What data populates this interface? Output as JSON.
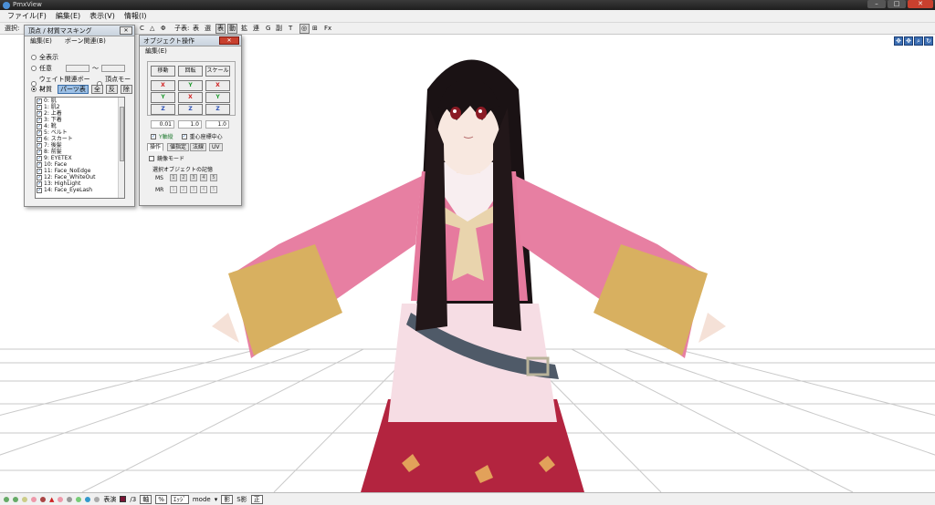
{
  "titlebar": {
    "title": "PmxView"
  },
  "menu": [
    "ファイル(F)",
    "編集(E)",
    "表示(V)",
    "情報(I)"
  ],
  "toolbar": {
    "select_label": "選択:",
    "items": [
      "C",
      "△",
      "Φ",
      "子表:",
      "表",
      "選",
      "表",
      "動",
      "拡",
      "連",
      "G",
      "副",
      "T",
      "Fx"
    ]
  },
  "mask_panel": {
    "title": "頂点 / 材質マスキング",
    "menu_edit": "編集(E)",
    "menu_bone": "ボーン関連(B)",
    "opt_all": "全表示",
    "opt_range": "任意",
    "range_sep": "〜",
    "opt_weight": "ウェイト関連ボーン",
    "opt_morph": "頂点モーフ",
    "opt_material": "材質",
    "btn_part": "パーツ表",
    "btn_all": "全",
    "btn_invert": "反",
    "btn_remove": "除",
    "materials": [
      "0: 肌",
      "1: 肌2",
      "2: 上着",
      "3: 下着",
      "4: 靴",
      "5: ベルト",
      "6: スカート",
      "7: 後髪",
      "8: 前髪",
      "9: EYETEX",
      "10: Face",
      "11: Face_NoEdge",
      "12: Face_WhiteOut",
      "13: HighLight",
      "14: Face_EyeLash"
    ]
  },
  "object_panel": {
    "title": "オブジェクト操作",
    "menu_edit": "編集(E)",
    "btn_move": "移動",
    "btn_rotate": "回転",
    "btn_scale": "スケール",
    "axis_x": "X",
    "axis_y": "Y",
    "axis_z": "Z",
    "val_move": "0.01",
    "val_rotate": "1.0",
    "val_scale": "1.0",
    "chk_yaxis": "Y軸縦",
    "chk_center": "重心座標中心",
    "tabs": [
      "操作",
      "値指定",
      "法線",
      "UV"
    ],
    "chk_mirror": "鏡像モード",
    "memory_label": "選択オブジェクトの記憶",
    "ms_label": "MS",
    "mr_label": "MR",
    "slots": [
      "1",
      "2",
      "3",
      "4",
      "5"
    ]
  },
  "status": {
    "items": [
      "表演",
      "/3",
      "軸",
      "%",
      "ｴｯｼﾞ",
      "mode",
      "影",
      "S影",
      "正"
    ]
  },
  "colors": {
    "accent": "#3c6fb4",
    "close": "#c8402e",
    "material_swatch": "#7a1536"
  }
}
